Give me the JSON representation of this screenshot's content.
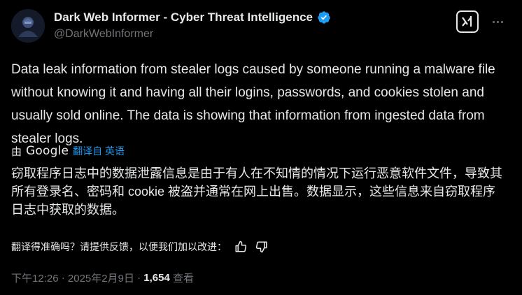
{
  "author": {
    "display_name": "Dark Web Informer - Cyber Threat Intelligence",
    "handle": "@DarkWebInformer",
    "verified": true,
    "avatar_icon": "avatar-image"
  },
  "actions": {
    "grok_icon": "grok-icon",
    "more_icon": "more-options-icon"
  },
  "tweet": {
    "text": "Data leak information from stealer logs caused by someone running a malware file without knowing it and having all their logins, passwords, and cookies stolen and usually sold online. The data is showing that information from ingested data from stealer logs."
  },
  "translation": {
    "by_label": "由",
    "provider": "Google",
    "translated_from": "翻译自 英语",
    "text": "窃取程序日志中的数据泄露信息是由于有人在不知情的情况下运行恶意软件文件，导致其所有登录名、密码和 cookie 被盗并通常在网上出售。数据显示，这些信息来自窃取程序日志中获取的数据。",
    "feedback_prompt": "翻译得准确吗？请提供反馈，以便我们加以改进："
  },
  "meta": {
    "time": "下午12:26",
    "separator": " · ",
    "date": "2025年2月9日",
    "views_count": "1,654",
    "views_label": "查看"
  },
  "colors": {
    "background": "#000000",
    "text": "#e7e9ea",
    "secondary": "#71767b",
    "accent": "#1d9bf0"
  }
}
